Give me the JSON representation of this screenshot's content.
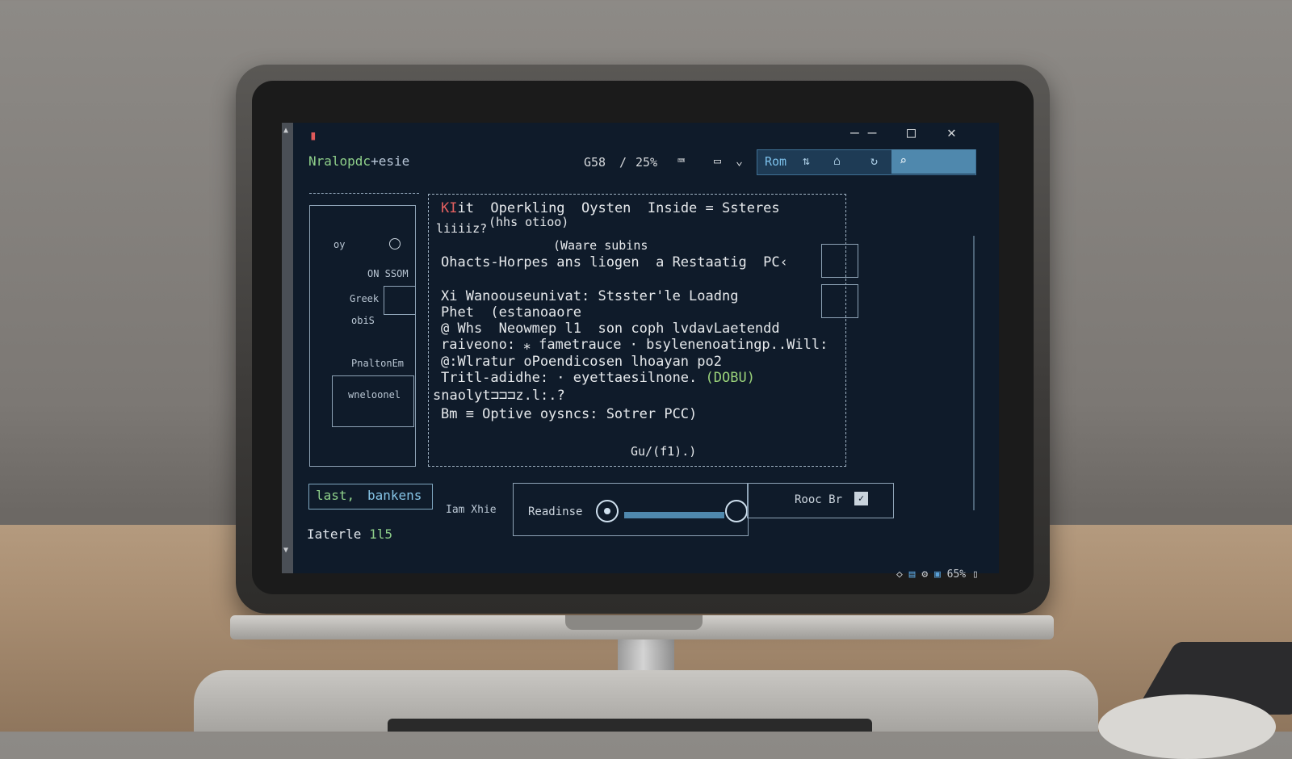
{
  "window": {
    "app_icon": "app-icon",
    "title_primary": "Nralopdc",
    "title_secondary": "+esie",
    "controls": {
      "minimize": "–  –",
      "maximize": "□",
      "close": "✕"
    }
  },
  "toolbar": {
    "value": "G58",
    "sep": "/",
    "zoom": "25%",
    "rom_label": "Rom",
    "icons": [
      "keyboard-icon",
      "clipboard-icon",
      "chevron-down-icon",
      "sort-icon",
      "home-icon",
      "refresh-icon",
      "search-icon"
    ]
  },
  "left_panel": {
    "labels": [
      "oy",
      "ON SSOM",
      "Greek",
      "obiS",
      "PnaltonEm",
      "wneloonel"
    ]
  },
  "main": {
    "line1_prefix": "KI",
    "line1_rest": "it  Operkling  Oysten  Inside = Ssteres",
    "line2": "liiiiz?",
    "line2b": "(hhs otioo)",
    "line3": "(Waare subins",
    "line4": "Ohacts-Horpes ans liogen  a Restaatig  PC‹",
    "line5": "Xi Wanoouseunivat: Stsster'le Loadng",
    "line6": "Phet  (estanoaore",
    "line7": "@ Whs  Neowmep l1  son coph lvdavLaetendd",
    "line8": "raiveono: ⁎ fametrauce · bsylenenoatingp..Will:",
    "line9": "@:Wlratur oPoendicosen lhoayan po2",
    "line10_main": "Tritl-adidhe: · eyettaesilnone.",
    "line10_tag": "(DOBU)",
    "line11": "snaolyt⊐⊐⊐z.l:.?",
    "line12": "Bm ≡ Optive oysncs: Sotrer PCC)",
    "line13": "Gu/(f1).)"
  },
  "bottom": {
    "btn_last_1": "last,",
    "btn_last_2": "bankens",
    "iam_label": "Iam Xhie",
    "status_label": "Iaterle",
    "status_value": "1l5",
    "readiness_label": "Readinse",
    "readiness_level": 0.9,
    "root_label": "Rooc Br",
    "root_checked": true
  },
  "system_tray": {
    "icons": [
      "diamond-icon",
      "battery-icon",
      "gear-icon",
      "window-icon"
    ],
    "percent": "65%"
  }
}
